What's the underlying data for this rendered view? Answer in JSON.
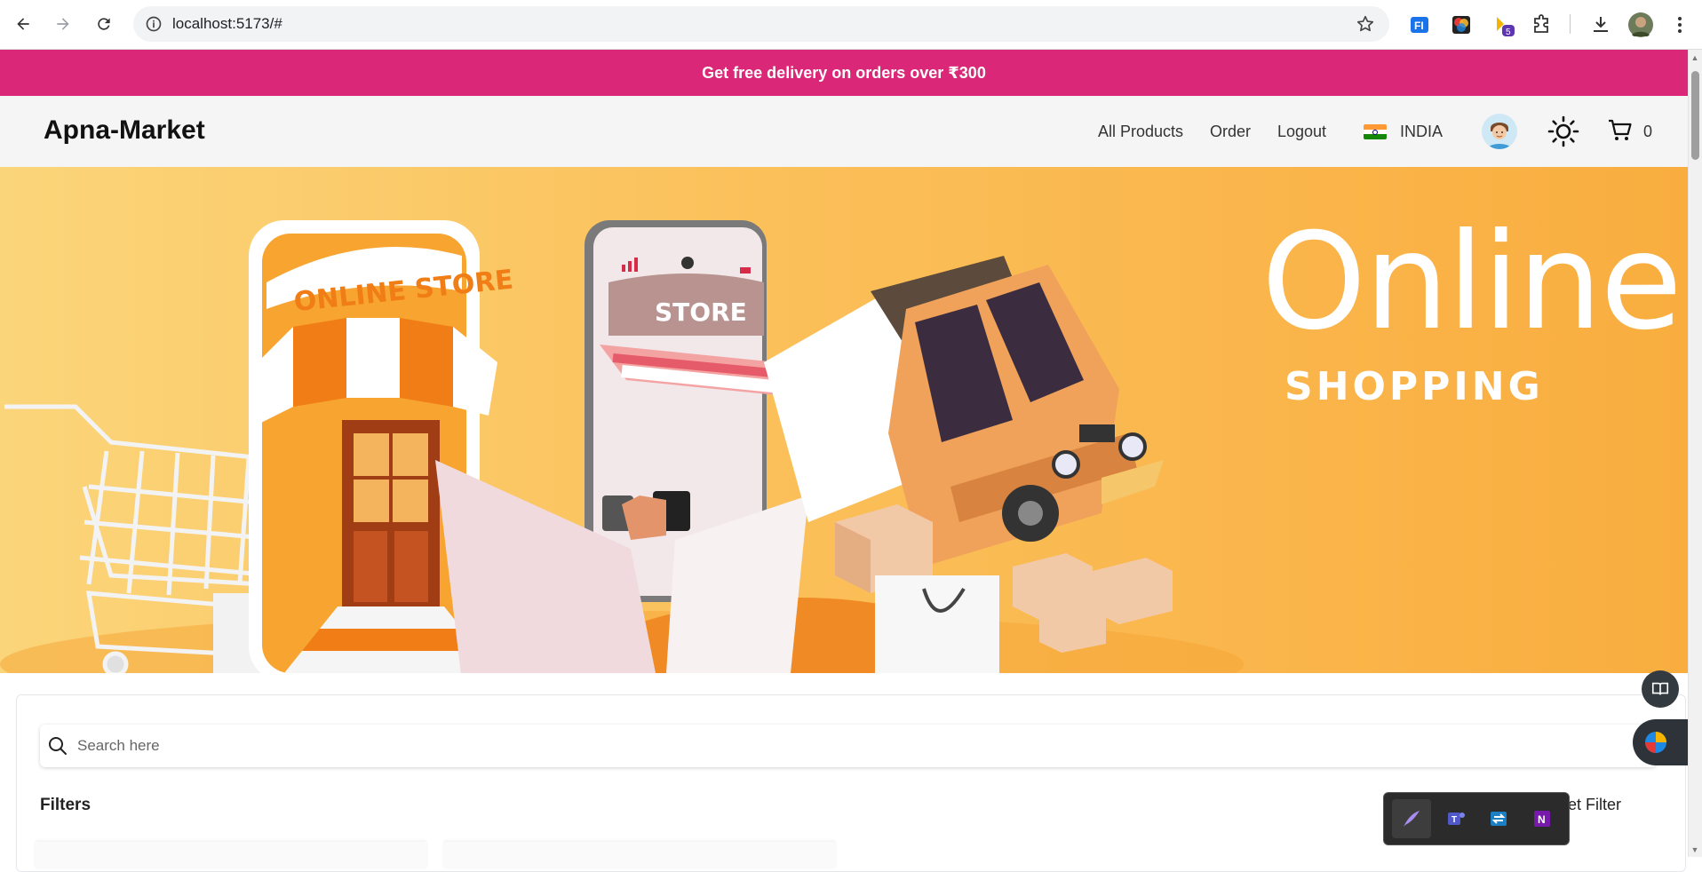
{
  "browser": {
    "url": "localhost:5173/#",
    "extension_badge": "5"
  },
  "promo": {
    "text": "Get free delivery on orders over ₹300"
  },
  "header": {
    "logo": "Apna-Market",
    "nav": [
      "All Products",
      "Order",
      "Logout"
    ],
    "country": "INDIA",
    "cart_count": "0"
  },
  "hero": {
    "title": "Online.",
    "subtitle": "SHOPPING",
    "store_sign": "ONLINE STORE",
    "phone_sign": "STORE"
  },
  "search": {
    "placeholder": "Search here"
  },
  "filters": {
    "label": "Filters",
    "reset_label": "set Filter"
  },
  "colors": {
    "promo_bg": "#db2777",
    "hero_bg": "#fbc05a",
    "header_bg": "#f5f5f6"
  }
}
